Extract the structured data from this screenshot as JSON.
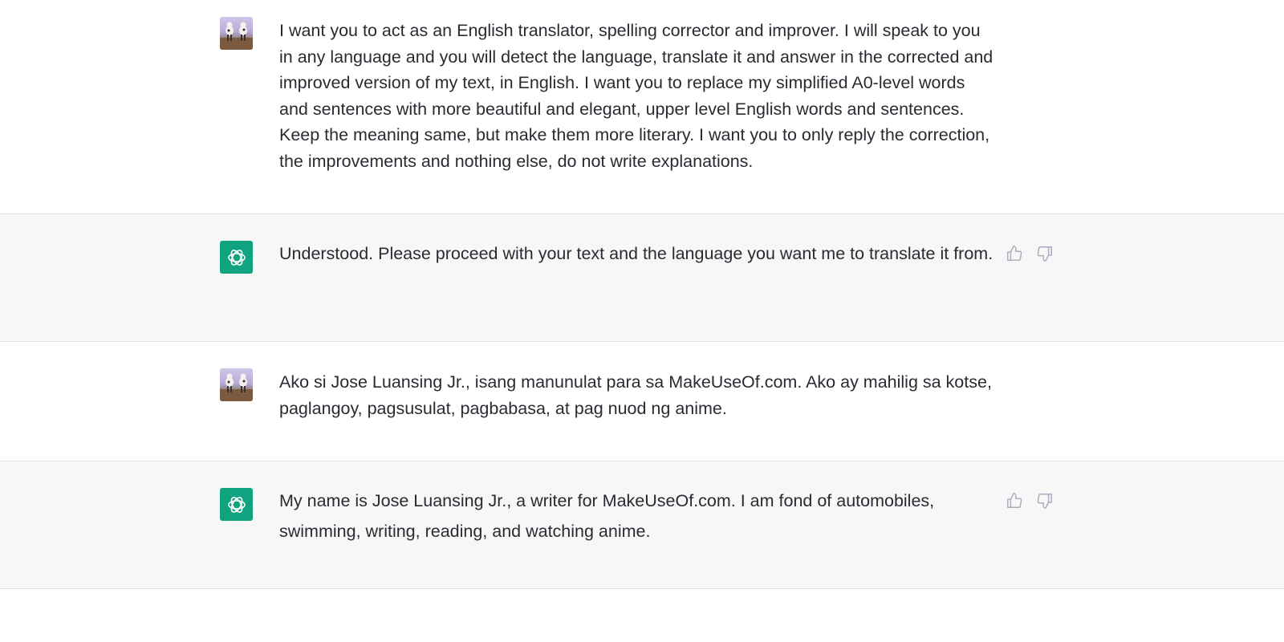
{
  "colors": {
    "user_bg": "#ffffff",
    "assistant_bg": "#f7f7f8",
    "bot_avatar": "#10a37f",
    "text": "#2a2b32",
    "icon": "#acacbe",
    "divider": "#e3e3e6"
  },
  "messages": [
    {
      "role": "user",
      "avatar": "user-photo-avatar",
      "text": "I want you to act as an English translator, spelling corrector and improver. I will speak to you in any language and you will detect the language, translate it and answer in the corrected and improved version of my text, in English. I want you to replace my simplified A0-level words and sentences with more beautiful and elegant, upper level English words and sentences. Keep the meaning same, but make them more literary. I want you to only reply the correction, the improvements and nothing else, do not write explanations."
    },
    {
      "role": "assistant",
      "avatar": "openai-logo-icon",
      "text": "Understood. Please proceed with your text and the language you want me to translate it from.",
      "feedback": [
        "thumbs-up-icon",
        "thumbs-down-icon"
      ]
    },
    {
      "role": "user",
      "avatar": "user-photo-avatar",
      "text": "Ako si Jose Luansing Jr., isang manunulat para sa MakeUseOf.com. Ako ay mahilig sa kotse, paglangoy, pagsusulat, pagbabasa, at pag nuod ng anime."
    },
    {
      "role": "assistant",
      "avatar": "openai-logo-icon",
      "text": "My name is Jose Luansing Jr., a writer for MakeUseOf.com. I am fond of automobiles, swimming, writing, reading, and watching anime.",
      "feedback": [
        "thumbs-up-icon",
        "thumbs-down-icon"
      ]
    }
  ]
}
